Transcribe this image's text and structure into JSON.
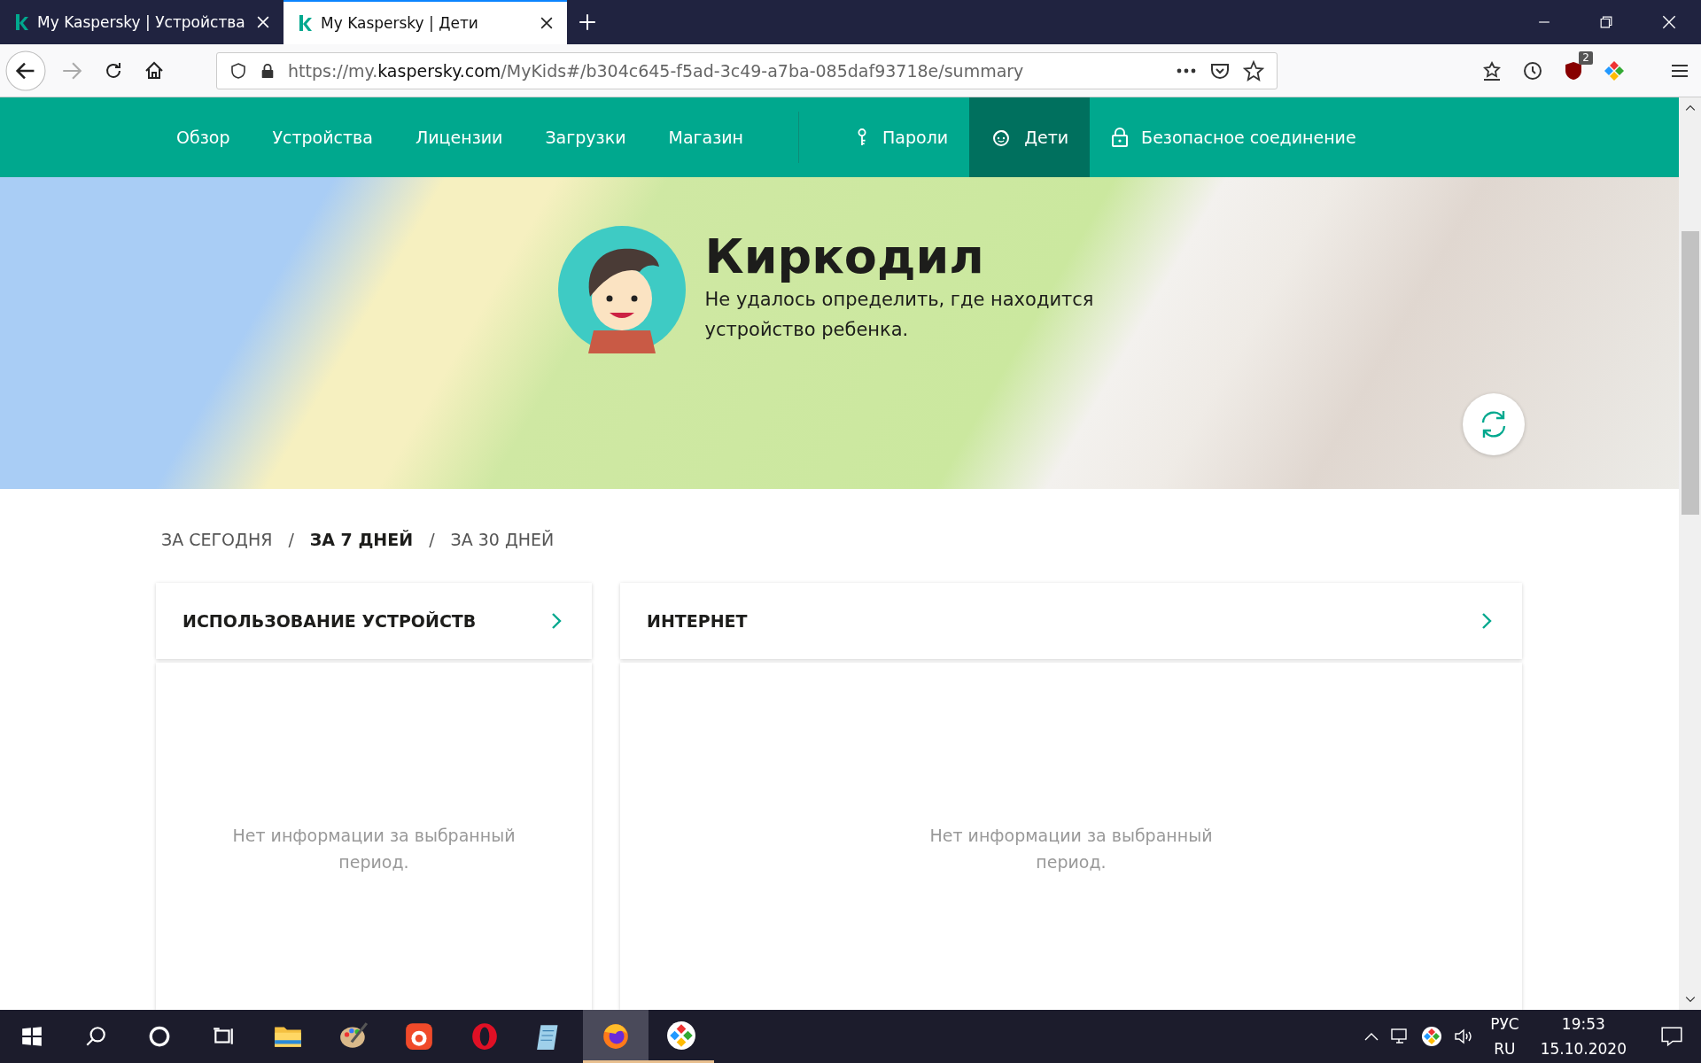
{
  "browser": {
    "tabs": [
      {
        "title": "My Kaspersky | Устройства",
        "selected": false
      },
      {
        "title": "My Kaspersky | Дети",
        "selected": true
      }
    ],
    "address": {
      "scheme": "https://my.",
      "domain": "kaspersky.com",
      "path": "/MyKids#/b304c645-f5ad-3c49-a7ba-085daf93718e/summary"
    },
    "extension_badge": "2"
  },
  "nav": {
    "items": [
      {
        "label": "Обзор",
        "kind": "plain",
        "selected": false
      },
      {
        "label": "Устройства",
        "kind": "plain",
        "selected": false
      },
      {
        "label": "Лицензии",
        "kind": "plain",
        "selected": false
      },
      {
        "label": "Загрузки",
        "kind": "plain",
        "selected": false
      },
      {
        "label": "Магазин",
        "kind": "plain",
        "selected": false
      },
      {
        "label": "Пароли",
        "kind": "key",
        "selected": false
      },
      {
        "label": "Дети",
        "kind": "kid",
        "selected": true
      },
      {
        "label": "Безопасное соединение",
        "kind": "lock",
        "selected": false
      }
    ]
  },
  "hero": {
    "name": "Киркодил",
    "message": "Не удалось определить, где находится устройство ребенка."
  },
  "periods": [
    {
      "label": "ЗА СЕГОДНЯ",
      "selected": false
    },
    {
      "label": "ЗА 7 ДНЕЙ",
      "selected": true
    },
    {
      "label": "ЗА 30 ДНЕЙ",
      "selected": false
    }
  ],
  "period_separators": [
    "/",
    "/"
  ],
  "cards": [
    {
      "title": "ИСПОЛЬЗОВАНИЕ УСТРОЙСТВ",
      "empty_text": "Нет информации за выбранный период."
    },
    {
      "title": "ИНТЕРНЕТ",
      "empty_text": "Нет информации за выбранный период."
    }
  ],
  "taskbar": {
    "apps": [
      {
        "kind": "folder",
        "selected": false,
        "running": false
      },
      {
        "kind": "paint",
        "selected": false,
        "running": false
      },
      {
        "kind": "recorder",
        "selected": false,
        "running": false
      },
      {
        "kind": "opera",
        "selected": false,
        "running": false
      },
      {
        "kind": "notepad",
        "selected": false,
        "running": false
      },
      {
        "kind": "firefox",
        "selected": true,
        "running": true
      },
      {
        "kind": "diamond",
        "selected": false,
        "running": true
      }
    ],
    "language": "РУС",
    "layout": "RU",
    "time": "19:53",
    "date": "15.10.2020"
  }
}
